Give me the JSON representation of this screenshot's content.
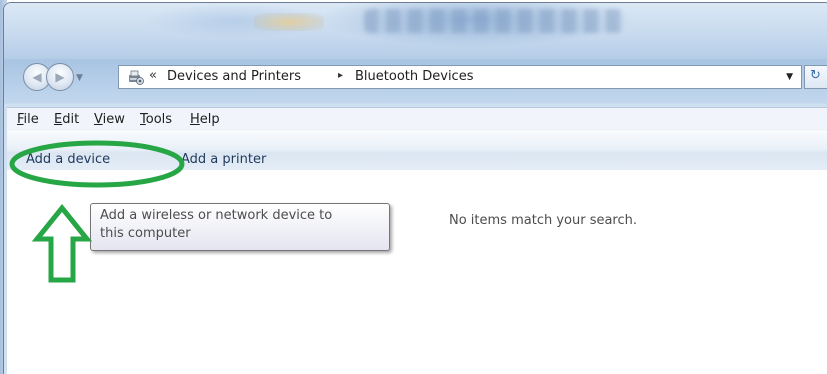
{
  "address_bar": {
    "chevron": "«",
    "crumbs": [
      "Devices and Printers",
      "Bluetooth Devices"
    ],
    "separator": "▸",
    "dropdown_icon": "chevron-down-icon"
  },
  "menu": {
    "items": [
      "File",
      "Edit",
      "View",
      "Tools",
      "Help"
    ]
  },
  "commands": {
    "add_device": "Add a device",
    "add_printer": "Add a printer"
  },
  "tooltip": {
    "line1": "Add a wireless or network device to",
    "line2": "this computer"
  },
  "content": {
    "empty_message": "No items match your search."
  },
  "annotation": {
    "color": "#27a645",
    "shapes": [
      "ellipse-highlight",
      "up-arrow"
    ]
  }
}
